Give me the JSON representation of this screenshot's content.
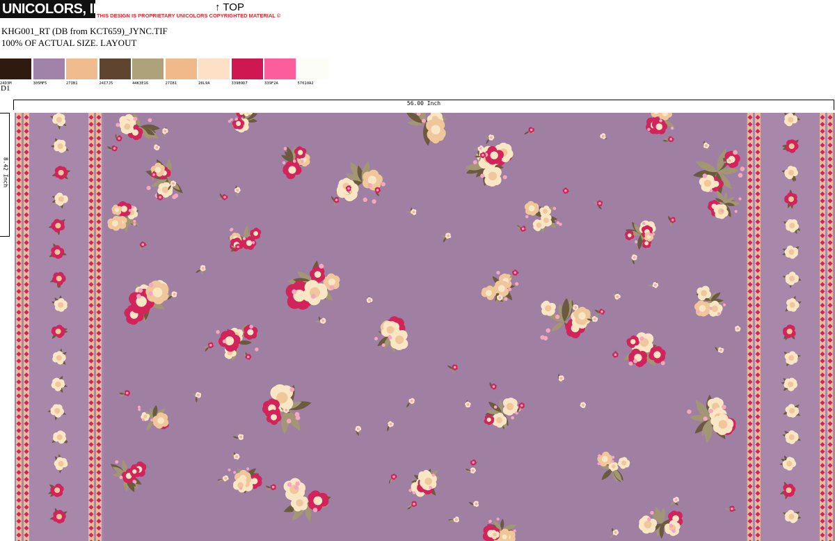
{
  "header": {
    "logo_text": "UNICOLORS, INC.",
    "proprietary_notice": "THIS DESIGN IS PROPRIETARY UNICOLORS COPYRIGHTED MATERIAL ©",
    "top_marker": "↑ TOP"
  },
  "file": {
    "name": "KHG001_RT (DB from KCT659)_JYNC.TIF",
    "size_info": "100% OF ACTUAL SIZE. LAYOUT"
  },
  "swatches": [
    {
      "code": "24D3M",
      "color": "#2e1a0e"
    },
    {
      "code": "305MF5",
      "color": "#a183a9"
    },
    {
      "code": "27IB1",
      "color": "#f0bb8d"
    },
    {
      "code": "24I7J5",
      "color": "#5f4430"
    },
    {
      "code": "44K3E16",
      "color": "#aea27a"
    },
    {
      "code": "27IB1",
      "color": "#f0b98a"
    },
    {
      "code": "28L9A",
      "color": "#fde0c6"
    },
    {
      "code": "339B9D7",
      "color": "#cf1752"
    },
    {
      "code": "339F2A",
      "color": "#fc5e9c"
    },
    {
      "code": "57010A2",
      "color": "#fdfdf8"
    }
  ],
  "design_id": "D1",
  "rulers": {
    "width_label": "56.00 Inch",
    "height_label": "8.42 Inch"
  },
  "fabric": {
    "background": "#9f7fa2",
    "border_ground": "#a788ab",
    "pink": "#d2235a",
    "light_pink": "#f4a7bf",
    "cream": "#f8e6c4",
    "peach": "#f0c79a",
    "leaf": "#6b5a3e",
    "leaf_light": "#a39674"
  }
}
